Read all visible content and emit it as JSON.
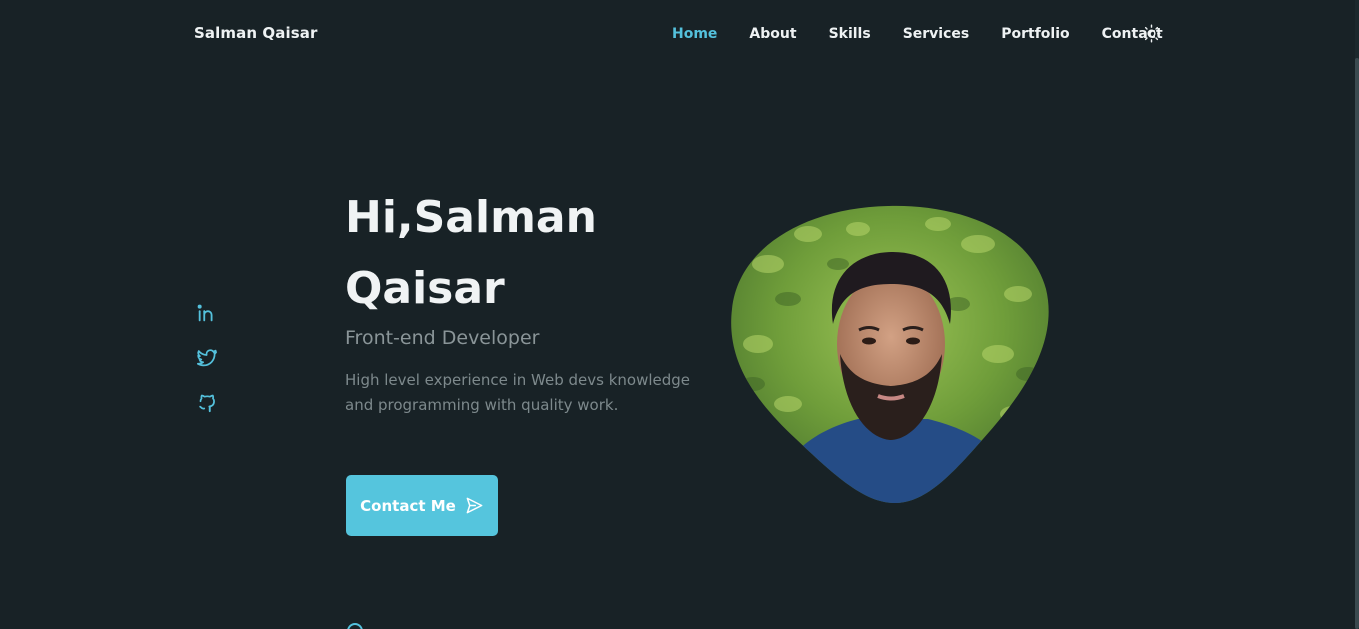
{
  "header": {
    "logo": "Salman Qaisar",
    "nav": [
      {
        "label": "Home",
        "active": true
      },
      {
        "label": "About",
        "active": false
      },
      {
        "label": "Skills",
        "active": false
      },
      {
        "label": "Services",
        "active": false
      },
      {
        "label": "Portfolio",
        "active": false
      },
      {
        "label": "Contact",
        "active": false
      }
    ],
    "theme_toggle_icon": "sun-icon"
  },
  "social": [
    {
      "icon": "linkedin-icon"
    },
    {
      "icon": "twitter-icon"
    },
    {
      "icon": "github-icon"
    }
  ],
  "hero": {
    "title_line1": "Hi,Salman",
    "title_line2": "Qaisar",
    "subtitle": "Front-end Developer",
    "description": "High level experience in Web devs knowledge and programming with quality work.",
    "button_label": "Contact Me",
    "button_icon": "send-icon",
    "profile_image": "profile-photo"
  },
  "colors": {
    "background": "#182226",
    "accent": "#54c1dc",
    "text": "#eef2f3",
    "muted": "#7d898c"
  }
}
